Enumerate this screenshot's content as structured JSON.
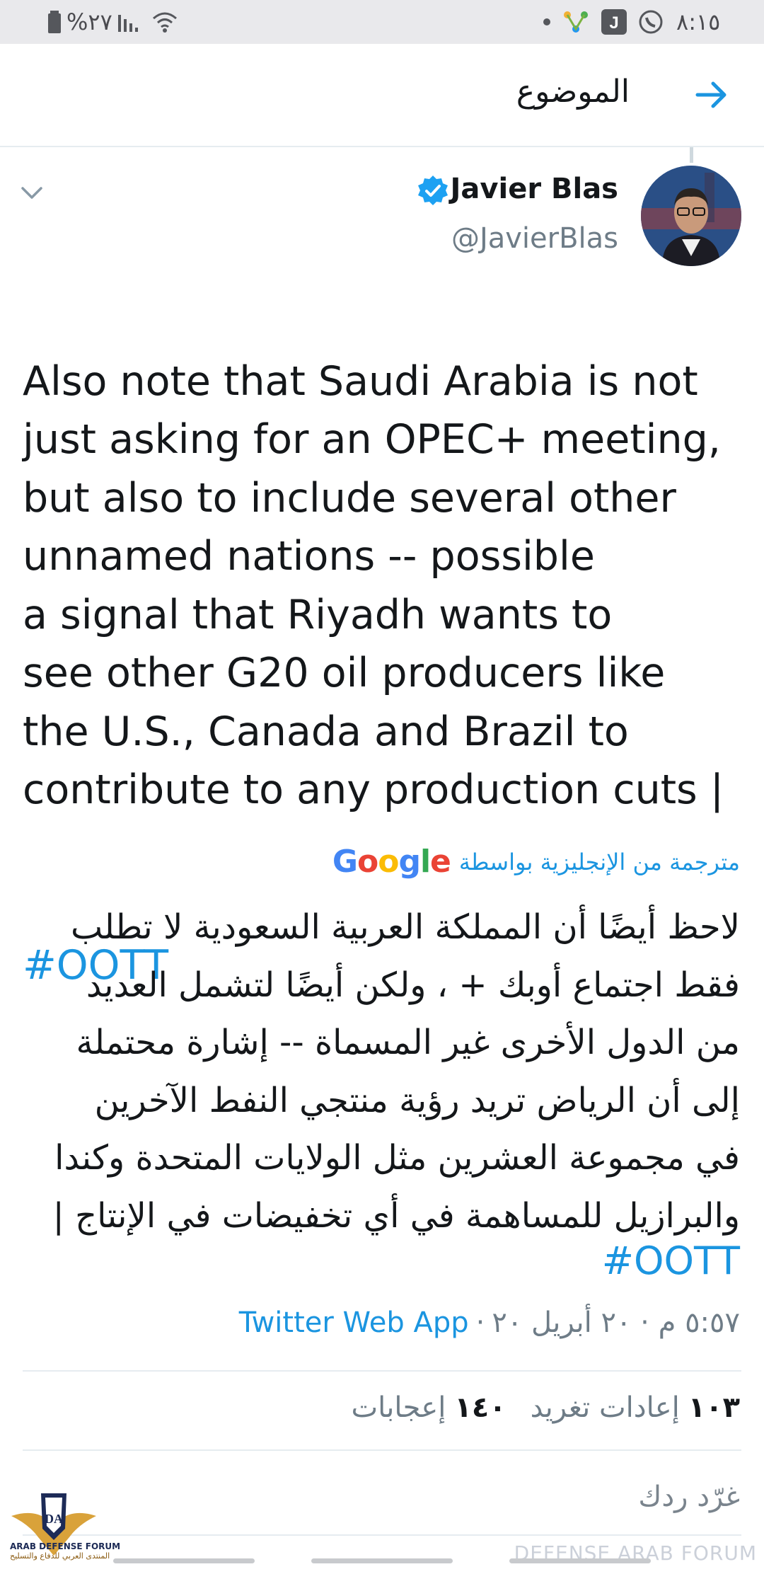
{
  "status_bar": {
    "time": "٨:١٥",
    "battery_text": "%٢٧"
  },
  "header": {
    "title": "الموضوع"
  },
  "tweet": {
    "author_name": "Javier Blas",
    "author_handle": "@JavierBlas",
    "text": "Also note that Saudi Arabia is not\njust asking for an OPEC+ meeting,\nbut also to include several other\nunnamed nations -- possible\na signal that Riyadh wants to\nsee other G20 oil producers like\nthe U.S., Canada and Brazil to\ncontribute to any production cuts |",
    "hashtag": "#OOTT",
    "translated_label": "مترجمة من الإنجليزية بواسطة",
    "translation_provider": "Google",
    "translation": "لاحظ أيضًا أن المملكة العربية السعودية لا تطلب\nفقط اجتماع أوبك + ، ولكن أيضًا لتشمل العديد\nمن الدول الأخرى غير المسماة -- إشارة محتملة\nإلى أن الرياض تريد رؤية منتجي النفط الآخرين\nفي مجموعة العشرين مثل الولايات المتحدة وكندا\nوالبرازيل للمساهمة في أي تخفيضات في الإنتاج |",
    "translation_hashtag": "#OOTT",
    "timestamp": "٥:٥٧ م · ٢٠ أبريل ٢٠",
    "source": "Twitter Web App",
    "retweets_count": "١٠٣",
    "retweets_label": "إعادات تغريد",
    "likes_count": "١٤٠",
    "likes_label": "إعجابات"
  },
  "reply": {
    "placeholder": "غرّد ردك"
  },
  "watermark": {
    "logo_text": "ARAB DEFENSE FORUM",
    "logo_subtext": "المنتدى العربي للدفاع والتسليح",
    "corner_text": "DEFENSE ARAB FORUM"
  },
  "colors": {
    "accent": "#1b95e0",
    "text": "#14171a",
    "secondary": "#6e7c87",
    "divider": "#e6ecf0"
  }
}
